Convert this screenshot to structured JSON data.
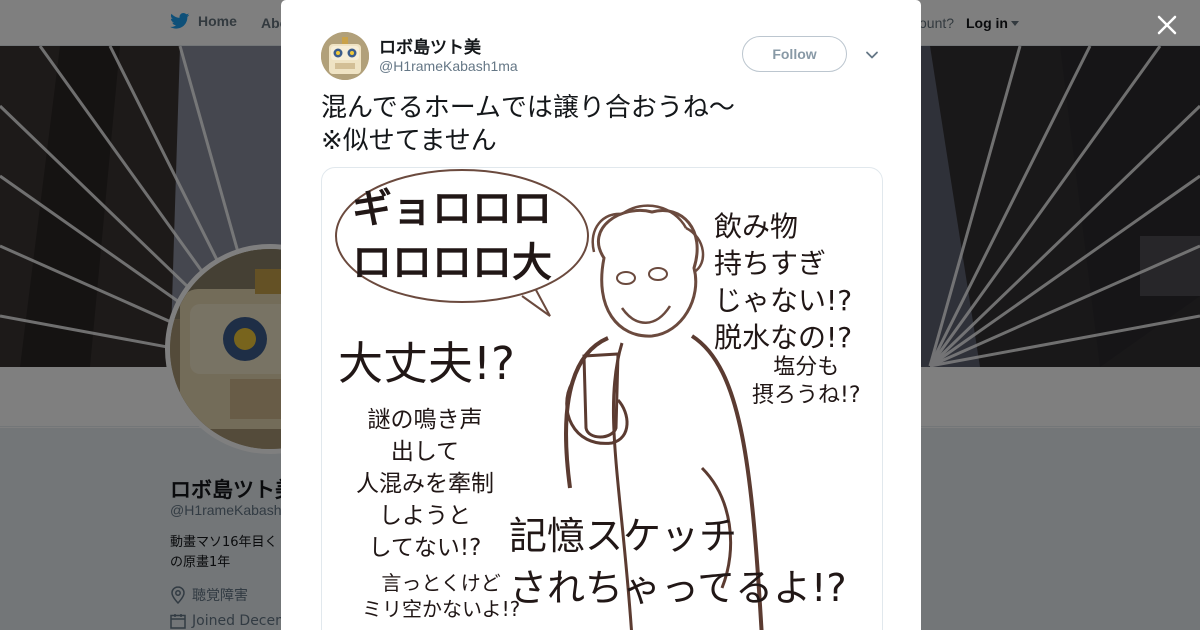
{
  "topnav": {
    "home_label": "Home",
    "about_label": "Abo",
    "account_prompt": "ccount?",
    "login_label": "Log in"
  },
  "profile": {
    "name": "ロボ島ツト美",
    "handle": "@H1rameKabash",
    "bio_lines": [
      "動畫マソ16年目く",
      "の原畫1年"
    ],
    "location": "聴覚障害",
    "joined": "Joined Decem"
  },
  "tweet": {
    "author_name": "ロボ島ツト美",
    "author_handle": "@H1rameKabash1ma",
    "follow_label": "Follow",
    "text_lines": [
      "混んでるホームでは譲り合おうね〜",
      "※似せてません"
    ]
  },
  "image_captions": {
    "bubble_text_line1": "ギョロロロ",
    "bubble_text_line2": "ロロロロ大",
    "drinks": [
      "飲み物",
      "持ちすぎ",
      "じゃない!?",
      "脱水なの!?"
    ],
    "salt": [
      "塩分も",
      "摂ろうね!?"
    ],
    "daijoubu": "大丈夫!?",
    "noise": [
      "謎の鳴き声",
      "出して",
      "人混みを牽制",
      "しようと",
      "してない!?"
    ],
    "sketch": [
      "記憶スケッチ",
      "されちゃってるよ!?"
    ],
    "space": [
      "言っとくけど",
      "ミリ空かないよ!?"
    ]
  },
  "icons": {
    "home": "twitter-bird-icon",
    "close": "close-icon",
    "more": "chevron-down-icon",
    "location": "location-pin-icon",
    "calendar": "calendar-icon"
  },
  "colors": {
    "brand_blue": "#1da1f2",
    "overlay": "rgba(0,0,0,0.5)",
    "sketch_ink": "#5b3b31"
  }
}
